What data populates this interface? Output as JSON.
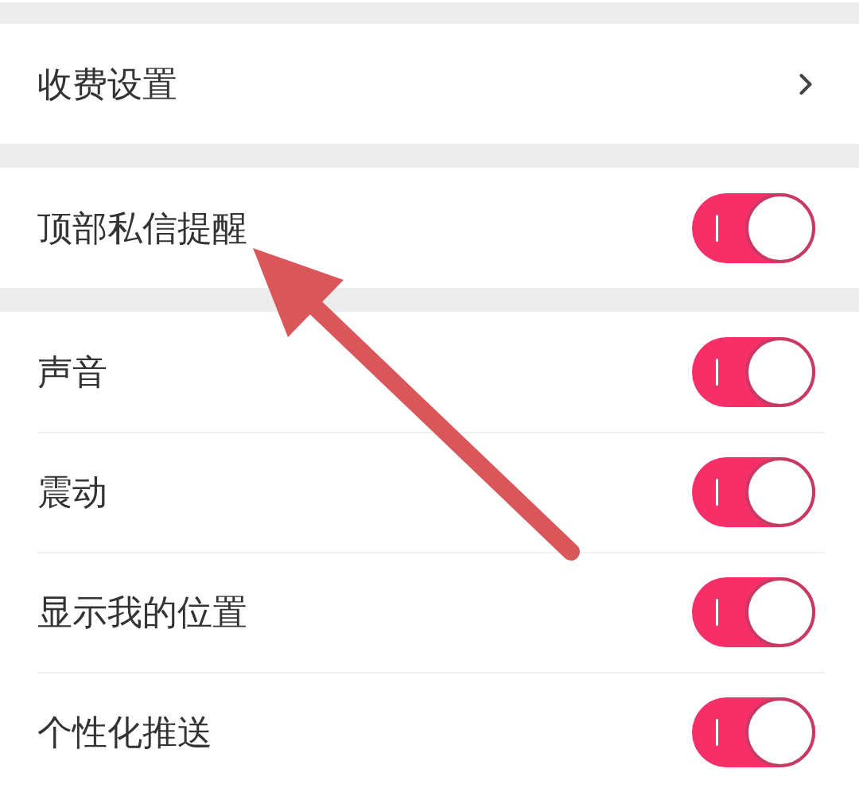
{
  "groups": [
    {
      "items": [
        {
          "kind": "link",
          "label": "收费设置"
        }
      ]
    },
    {
      "items": [
        {
          "kind": "toggle",
          "label": "顶部私信提醒",
          "on": true
        }
      ]
    },
    {
      "items": [
        {
          "kind": "toggle",
          "label": "声音",
          "on": true
        },
        {
          "kind": "toggle",
          "label": "震动",
          "on": true
        },
        {
          "kind": "toggle",
          "label": "显示我的位置",
          "on": true
        },
        {
          "kind": "toggle",
          "label": "个性化推送",
          "on": true
        }
      ]
    }
  ]
}
